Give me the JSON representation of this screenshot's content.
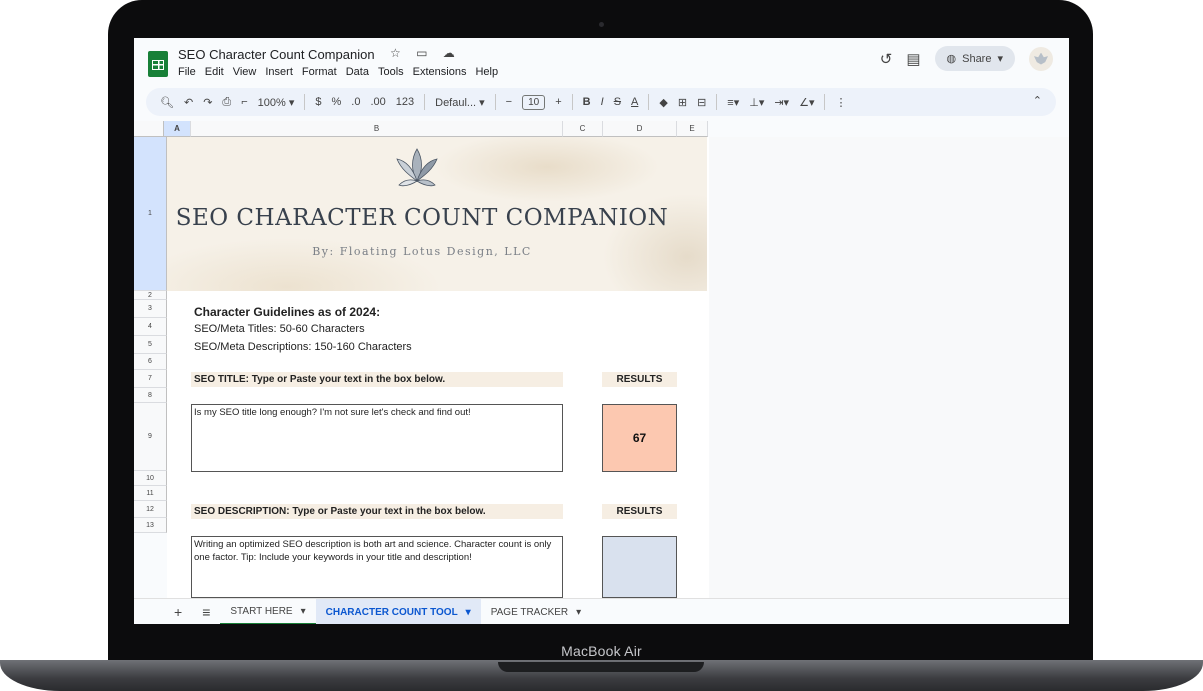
{
  "device": {
    "brand_label": "MacBook Air"
  },
  "app": {
    "title": "SEO Character Count Companion",
    "menu": [
      "File",
      "Edit",
      "View",
      "Insert",
      "Format",
      "Data",
      "Tools",
      "Extensions",
      "Help"
    ],
    "share_label": "Share",
    "title_icons": "☆ ▭ ☁"
  },
  "toolbar": {
    "zoom": "100%",
    "currency": "$",
    "percent": "%",
    "dec_less": ".0",
    "dec_more": ".00",
    "number_format": "123",
    "font": "Defaul...",
    "font_size": "10",
    "bold": "B",
    "italic": "I",
    "strike": "S",
    "text_color": "A"
  },
  "grid": {
    "columns": [
      "A",
      "B",
      "C",
      "D",
      "E"
    ],
    "rows": [
      "1",
      "2",
      "3",
      "4",
      "5",
      "6",
      "7",
      "8",
      "9",
      "10",
      "11",
      "12",
      "13"
    ]
  },
  "banner": {
    "title": "SEO CHARACTER COUNT COMPANION",
    "subtitle": "By: Floating Lotus Design, LLC"
  },
  "content": {
    "guidelines_title": "Character Guidelines as of 2024:",
    "guideline_titles": "SEO/Meta Titles: 50-60 Characters",
    "guideline_descriptions": "SEO/Meta Descriptions: 150-160 Characters",
    "seo_title_label": "SEO TITLE: Type or Paste your text in the box below.",
    "results_label": "RESULTS",
    "seo_title_text": "Is my SEO title long enough? I'm not sure let's check and find out!",
    "seo_title_result": "67",
    "seo_title_result_color": "#fcc8b0",
    "seo_desc_label": "SEO DESCRIPTION: Type or Paste your text in the box below.",
    "seo_desc_text": "Writing an optimized SEO description is both art and science. Character count is only one factor. Tip: Include your keywords in your title and description!",
    "seo_desc_result": "",
    "seo_desc_result_color": "#d9e1ee"
  },
  "sheets": {
    "add_icon": "+",
    "list_icon": "≡",
    "tabs": [
      "START HERE",
      "CHARACTER COUNT TOOL",
      "PAGE TRACKER"
    ]
  }
}
